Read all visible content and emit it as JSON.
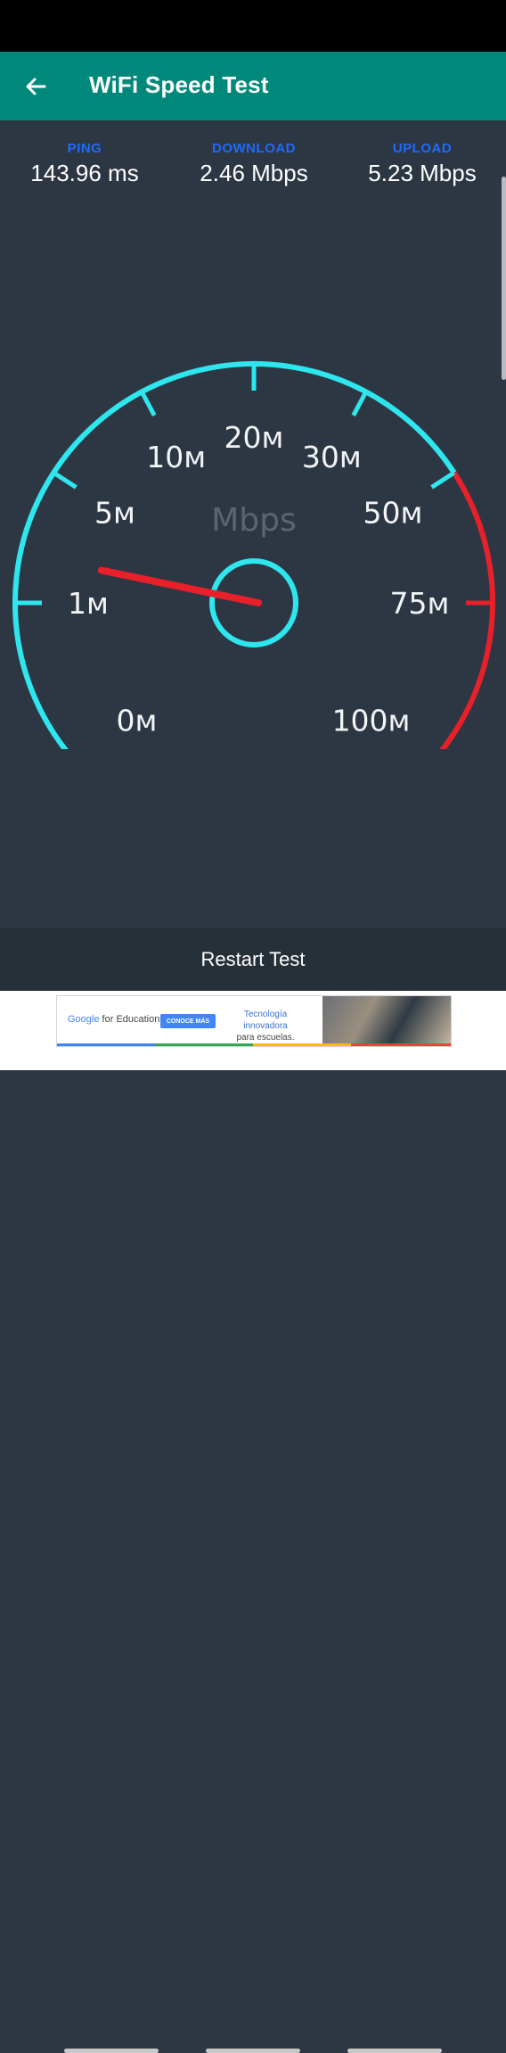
{
  "app": {
    "title": "WiFi Speed Test"
  },
  "metrics": [
    {
      "label": "PING",
      "value": "143.96 ms"
    },
    {
      "label": "DOWNLOAD",
      "value": "2.46 Mbps"
    },
    {
      "label": "UPLOAD",
      "value": "5.23 Mbps"
    }
  ],
  "gauge": {
    "unit": "Mbps",
    "ticks": [
      "0м",
      "1м",
      "5м",
      "10м",
      "20м",
      "30м",
      "50м",
      "75м",
      "100м"
    ],
    "red_zone_from_tick": "50м",
    "needle_value_mbps": 2.46,
    "colors": {
      "arc": "#2ee6ee",
      "red": "#e8202a",
      "needle": "#e8202a",
      "unit_text": "#5c6470"
    }
  },
  "actions": {
    "restart_label": "Restart Test"
  },
  "ad": {
    "brand_google": "Google",
    "brand_suffix": "for Education",
    "cta": "CONOCE MÁS",
    "line1": "Tecnología innovadora",
    "line2": "para escuelas."
  },
  "colors": {
    "appbar": "#00897b",
    "background": "#2d3744",
    "label_blue": "#1d6bff"
  }
}
